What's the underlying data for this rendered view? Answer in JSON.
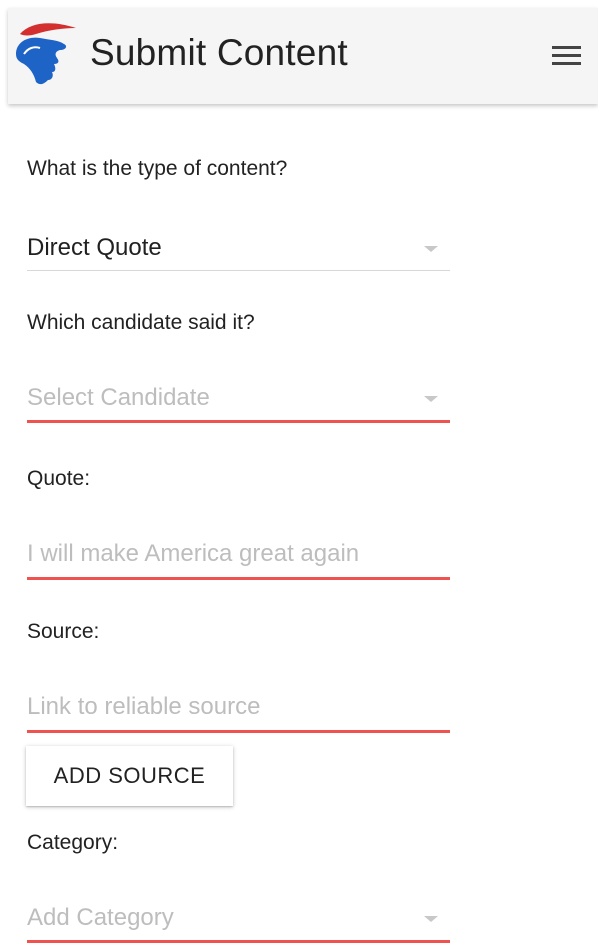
{
  "app_bar": {
    "title": "Submit Content",
    "logo_icon": "candidate-silhouette-logo",
    "menu_icon": "hamburger-menu-icon"
  },
  "form": {
    "content_type": {
      "label": "What is the type of content?",
      "value": "Direct Quote"
    },
    "candidate": {
      "label": "Which candidate said it?",
      "placeholder": "Select Candidate"
    },
    "quote": {
      "label": "Quote:",
      "placeholder": "I will make America great again"
    },
    "source": {
      "label": "Source:",
      "placeholder": "Link to reliable source",
      "add_button": "ADD SOURCE"
    },
    "category": {
      "label": "Category:",
      "placeholder": "Add Category"
    }
  },
  "colors": {
    "app_bar_bg": "#f5f5f5",
    "error_underline": "#ef5350",
    "logo_red": "#d32f2f",
    "logo_blue": "#1e63c6",
    "placeholder": "#bdbdbd"
  }
}
